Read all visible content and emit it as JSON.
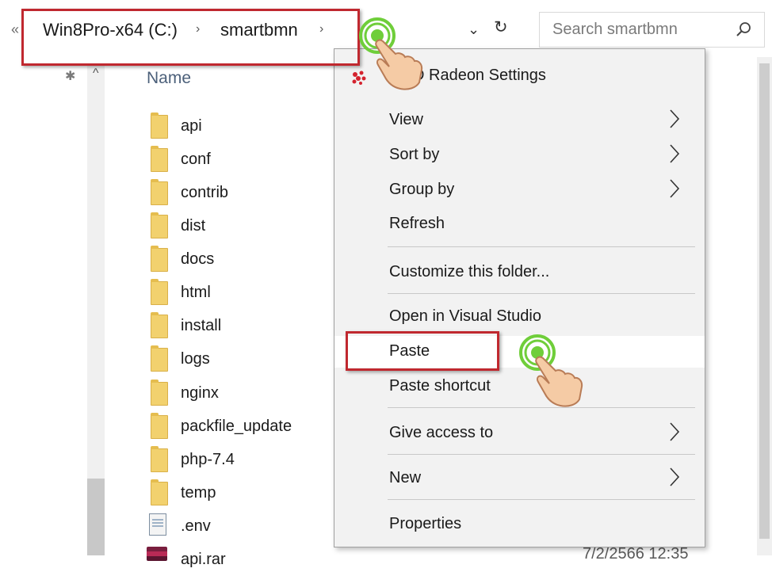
{
  "address_bar": {
    "back_glyph": "«",
    "breadcrumbs": [
      "Win8Pro-x64 (C:)",
      "smartbmn"
    ],
    "separator": "›",
    "dropdown_glyph": "⌄",
    "refresh_glyph": "↻",
    "search_placeholder": "Search smartbmn"
  },
  "nav": {
    "pin_glyph": "✱",
    "caret_glyph": "^"
  },
  "file_list": {
    "column_name": "Name",
    "folders": [
      "api",
      "conf",
      "contrib",
      "dist",
      "docs",
      "html",
      "install",
      "logs",
      "nginx",
      "packfile_update",
      "php-7.4",
      "temp"
    ],
    "files": [
      ".env",
      "api.rar"
    ],
    "partial_date": "7/2/2566 12:35"
  },
  "context_menu": {
    "items": [
      {
        "label": "AMD Radeon Settings",
        "icon": "amd-radeon-icon",
        "submenu": false
      },
      {
        "label": "View",
        "submenu": true
      },
      {
        "label": "Sort by",
        "submenu": true
      },
      {
        "label": "Group by",
        "submenu": true
      },
      {
        "label": "Refresh",
        "submenu": false
      },
      {
        "label": "Customize this folder...",
        "submenu": false
      },
      {
        "label": "Open in Visual Studio",
        "submenu": false
      },
      {
        "label": "Paste",
        "submenu": false,
        "highlighted": true
      },
      {
        "label": "Paste shortcut",
        "submenu": false
      },
      {
        "label": "Give access to",
        "submenu": true
      },
      {
        "label": "New",
        "submenu": true
      },
      {
        "label": "Properties",
        "submenu": false
      }
    ]
  },
  "annotations": {
    "highlight_color": "#c0282f",
    "cursor_ring_color": "#6fce3a",
    "cursor": "hand-pointer"
  }
}
